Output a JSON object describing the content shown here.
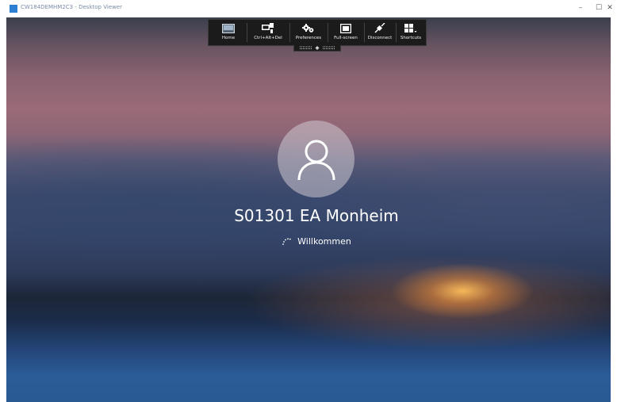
{
  "window": {
    "title": "CW184DEMHM2C3 - Desktop Viewer",
    "minimize_symbol": "–",
    "maximize_symbol": "☐",
    "close_symbol": "✕"
  },
  "toolbar": {
    "items": [
      {
        "label": "Home",
        "icon": "home-icon"
      },
      {
        "label": "Ctrl+Alt+Del",
        "icon": "ctrl-alt-del-icon"
      },
      {
        "label": "Preferences",
        "icon": "gears-icon"
      },
      {
        "label": "Full-screen",
        "icon": "fullscreen-icon"
      },
      {
        "label": "Disconnect",
        "icon": "disconnect-plug-icon"
      },
      {
        "label": "Shortcuts",
        "icon": "grid-shortcuts-icon"
      }
    ]
  },
  "lock_screen": {
    "user_name": "S01301 EA Monheim",
    "status": "Willkommen"
  },
  "colors": {
    "toolbar_bg": "#1b1b1b",
    "app_icon": "#2c7fd1",
    "text": "#ffffff"
  }
}
